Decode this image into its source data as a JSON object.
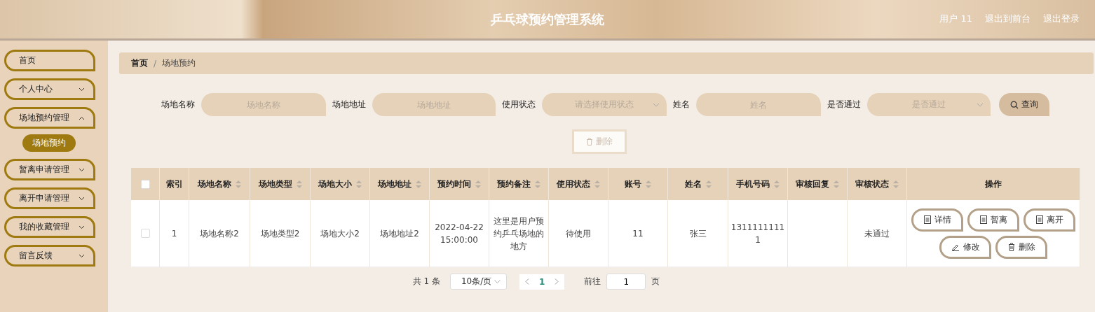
{
  "header": {
    "title": "乒乓球预约管理系统",
    "user": "用户 11",
    "links": [
      "退出到前台",
      "退出登录"
    ]
  },
  "sidebar": {
    "items": [
      {
        "label": "首页",
        "kind": "link",
        "selected": false
      },
      {
        "label": "个人中心",
        "kind": "submenu",
        "expanded": false,
        "selected": false
      },
      {
        "label": "场地预约管理",
        "kind": "submenu",
        "expanded": true,
        "selected": false,
        "children": [
          {
            "label": "场地预约",
            "selected": true
          }
        ]
      },
      {
        "label": "暂离申请管理",
        "kind": "submenu",
        "expanded": false,
        "selected": false
      },
      {
        "label": "离开申请管理",
        "kind": "submenu",
        "expanded": false,
        "selected": false
      },
      {
        "label": "我的收藏管理",
        "kind": "submenu",
        "expanded": false,
        "selected": false
      },
      {
        "label": "留言反馈",
        "kind": "submenu",
        "expanded": false,
        "selected": false
      }
    ]
  },
  "breadcrumb": {
    "separator": "/",
    "items": [
      "首页",
      "场地预约"
    ]
  },
  "filters": [
    {
      "label": "场地名称",
      "kind": "input",
      "placeholder": "场地名称"
    },
    {
      "label": "场地地址",
      "kind": "input",
      "placeholder": "场地地址"
    },
    {
      "label": "使用状态",
      "kind": "select",
      "placeholder": "请选择使用状态"
    },
    {
      "label": "姓名",
      "kind": "input",
      "placeholder": "姓名"
    },
    {
      "label": "是否通过",
      "kind": "select",
      "placeholder": "是否通过"
    }
  ],
  "search_button": "查询",
  "delete_button": {
    "label": "删除",
    "disabled": true
  },
  "table": {
    "select_all": {
      "checked": false
    },
    "columns": [
      {
        "label": "索引",
        "sortable": false
      },
      {
        "label": "场地名称",
        "sortable": true
      },
      {
        "label": "场地类型",
        "sortable": true
      },
      {
        "label": "场地大小",
        "sortable": true
      },
      {
        "label": "场地地址",
        "sortable": true
      },
      {
        "label": "预约时间",
        "sortable": true
      },
      {
        "label": "预约备注",
        "sortable": true
      },
      {
        "label": "使用状态",
        "sortable": true
      },
      {
        "label": "账号",
        "sortable": true
      },
      {
        "label": "姓名",
        "sortable": true
      },
      {
        "label": "手机号码",
        "sortable": true
      },
      {
        "label": "审核回复",
        "sortable": true
      },
      {
        "label": "审核状态",
        "sortable": true
      },
      {
        "label": "操作",
        "sortable": false
      }
    ],
    "rows": [
      {
        "checked": false,
        "cells": [
          "1",
          "场地名称2",
          "场地类型2",
          "场地大小2",
          "场地地址2",
          "2022-04-22 15:00:00",
          "这里是用户预约乒乓场地的地方",
          "待使用",
          "11",
          "张三",
          "13111111111",
          null,
          "未通过"
        ],
        "actions": [
          {
            "label": "详情",
            "kind": "doc"
          },
          {
            "label": "暂离",
            "kind": "doc"
          },
          {
            "label": "离开",
            "kind": "doc"
          },
          {
            "label": "修改",
            "kind": "edit"
          },
          {
            "label": "删除",
            "kind": "trash"
          }
        ]
      }
    ]
  },
  "pagination": {
    "total": "共 1 条",
    "page_size": "10条/页",
    "pages": [
      {
        "label": "1",
        "selected": true
      }
    ],
    "goto_label": "前往",
    "goto_value": "1",
    "goto_suffix": "页"
  }
}
